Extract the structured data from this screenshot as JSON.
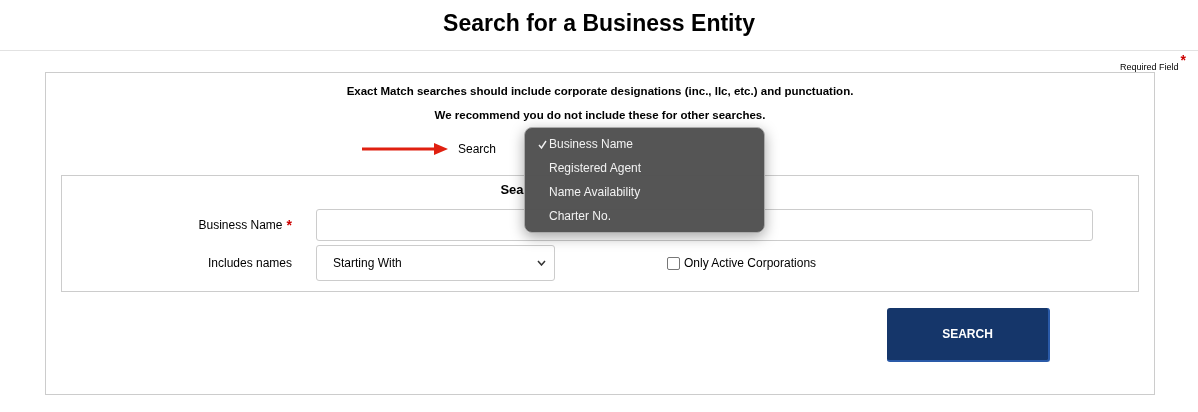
{
  "page_title": "Search for a Business Entity",
  "required_note": {
    "label": "Required Field",
    "mark": "*"
  },
  "notes": [
    "Exact Match searches should include corporate designations (inc., llc, etc.) and punctuation.",
    "We recommend you do not include these for other searches."
  ],
  "search_type": {
    "label": "Search",
    "menu": [
      {
        "label": "Business Name",
        "selected": true
      },
      {
        "label": "Registered Agent",
        "selected": false
      },
      {
        "label": "Name Availability",
        "selected": false
      },
      {
        "label": "Charter No.",
        "selected": false
      }
    ]
  },
  "panel": {
    "heading": "Sea",
    "business_name": {
      "label": "Business Name",
      "required_mark": "*"
    },
    "includes_names": {
      "label": "Includes names",
      "value": "Starting With"
    },
    "only_active": {
      "label": "Only Active Corporations",
      "checked": false
    }
  },
  "submit": "SEARCH"
}
